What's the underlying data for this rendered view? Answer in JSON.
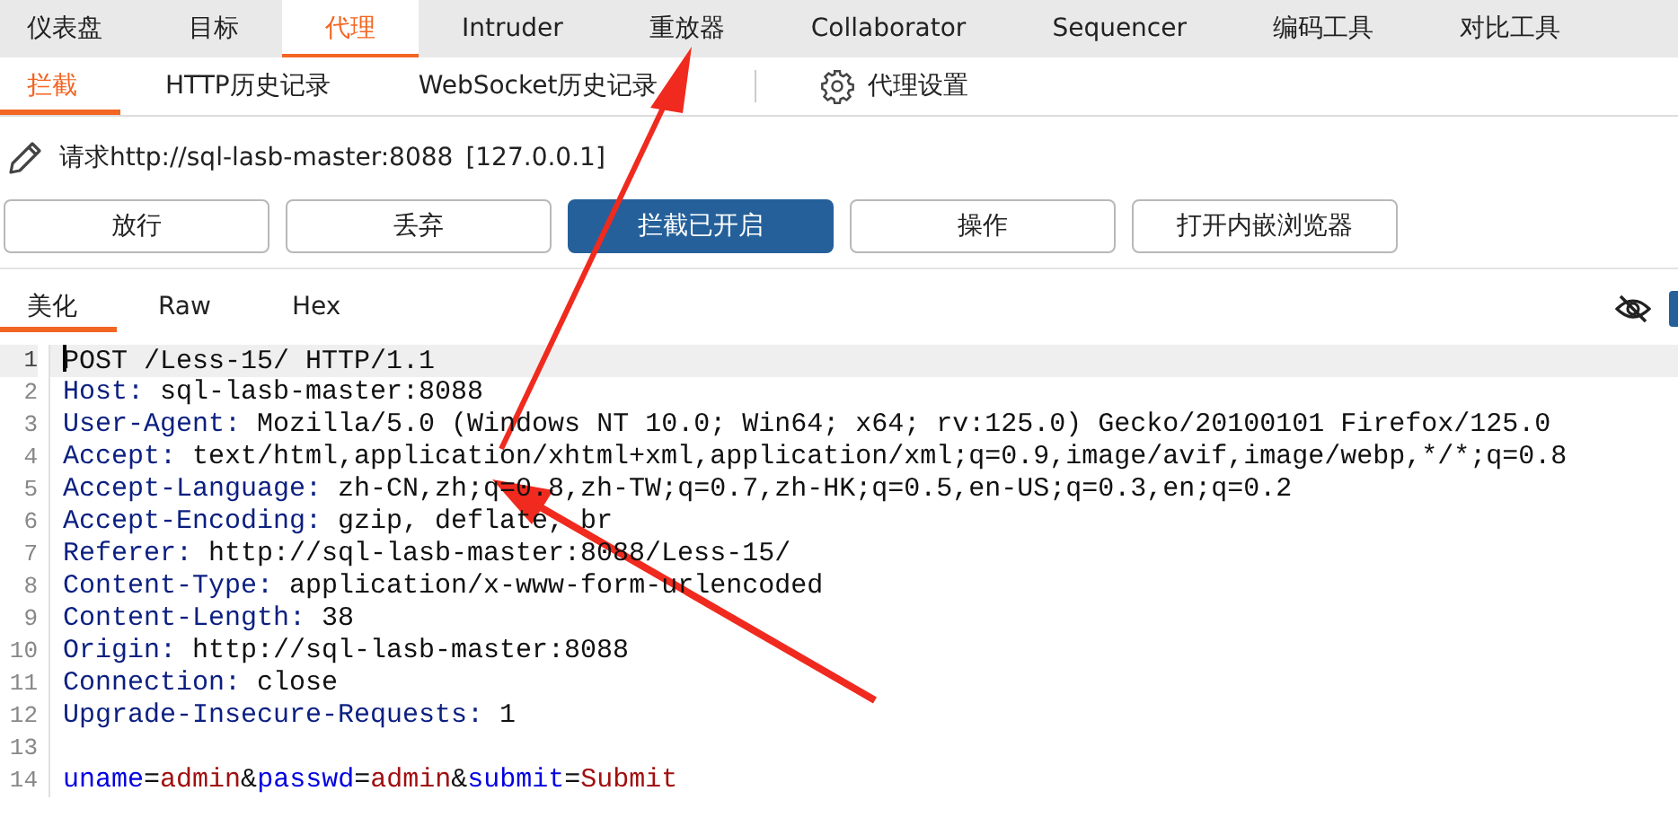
{
  "main_tabs": [
    {
      "label": "仪表盘",
      "selected": false
    },
    {
      "label": "目标",
      "selected": false
    },
    {
      "label": "代理",
      "selected": true
    },
    {
      "label": "Intruder",
      "selected": false
    },
    {
      "label": "重放器",
      "selected": false
    },
    {
      "label": "Collaborator",
      "selected": false
    },
    {
      "label": "Sequencer",
      "selected": false
    },
    {
      "label": "编码工具",
      "selected": false
    },
    {
      "label": "对比工具",
      "selected": false
    }
  ],
  "sub_tabs": [
    {
      "label": "拦截",
      "selected": true
    },
    {
      "label": "HTTP历史记录",
      "selected": false
    },
    {
      "label": "WebSocket历史记录",
      "selected": false
    }
  ],
  "settings_label": "代理设置",
  "request_info": {
    "url": "请求http://sql-lasb-master:8088",
    "ip": "[127.0.0.1]"
  },
  "buttons": [
    {
      "label": "放行",
      "on": false
    },
    {
      "label": "丢弃",
      "on": false
    },
    {
      "label": "拦截已开启",
      "on": true
    },
    {
      "label": "操作",
      "on": false
    },
    {
      "label": "打开内嵌浏览器",
      "on": false
    }
  ],
  "editor_tabs": [
    {
      "label": "美化",
      "selected": true
    },
    {
      "label": "Raw",
      "selected": false
    },
    {
      "label": "Hex",
      "selected": false
    }
  ],
  "lines": [
    {
      "number": "1",
      "current": true,
      "segments": [
        {
          "kind": "plain",
          "text": "POST /Less-15/ HTTP/1.1"
        }
      ]
    },
    {
      "number": "2",
      "current": false,
      "segments": [
        {
          "kind": "header",
          "text": "Host:"
        },
        {
          "kind": "plain",
          "text": " sql-lasb-master:8088"
        }
      ]
    },
    {
      "number": "3",
      "current": false,
      "segments": [
        {
          "kind": "header",
          "text": "User-Agent:"
        },
        {
          "kind": "plain",
          "text": " Mozilla/5.0 (Windows NT 10.0; Win64; x64; rv:125.0) Gecko/20100101 Firefox/125.0"
        }
      ]
    },
    {
      "number": "4",
      "current": false,
      "segments": [
        {
          "kind": "header",
          "text": "Accept:"
        },
        {
          "kind": "plain",
          "text": " text/html,application/xhtml+xml,application/xml;q=0.9,image/avif,image/webp,*/*;q=0.8"
        }
      ]
    },
    {
      "number": "5",
      "current": false,
      "segments": [
        {
          "kind": "header",
          "text": "Accept-Language:"
        },
        {
          "kind": "plain",
          "text": " zh-CN,zh;q=0.8,zh-TW;q=0.7,zh-HK;q=0.5,en-US;q=0.3,en;q=0.2"
        }
      ]
    },
    {
      "number": "6",
      "current": false,
      "segments": [
        {
          "kind": "header",
          "text": "Accept-Encoding:"
        },
        {
          "kind": "plain",
          "text": " gzip, deflate, br"
        }
      ]
    },
    {
      "number": "7",
      "current": false,
      "segments": [
        {
          "kind": "header",
          "text": "Referer:"
        },
        {
          "kind": "plain",
          "text": " http://sql-lasb-master:8088/Less-15/"
        }
      ]
    },
    {
      "number": "8",
      "current": false,
      "segments": [
        {
          "kind": "header",
          "text": "Content-Type:"
        },
        {
          "kind": "plain",
          "text": " application/x-www-form-urlencoded"
        }
      ]
    },
    {
      "number": "9",
      "current": false,
      "segments": [
        {
          "kind": "header",
          "text": "Content-Length:"
        },
        {
          "kind": "plain",
          "text": " 38"
        }
      ]
    },
    {
      "number": "10",
      "current": false,
      "segments": [
        {
          "kind": "header",
          "text": "Origin:"
        },
        {
          "kind": "plain",
          "text": " http://sql-lasb-master:8088"
        }
      ]
    },
    {
      "number": "11",
      "current": false,
      "segments": [
        {
          "kind": "header",
          "text": "Connection:"
        },
        {
          "kind": "plain",
          "text": " close"
        }
      ]
    },
    {
      "number": "12",
      "current": false,
      "segments": [
        {
          "kind": "header",
          "text": "Upgrade-Insecure-Requests:"
        },
        {
          "kind": "plain",
          "text": " 1"
        }
      ]
    },
    {
      "number": "13",
      "current": false
    },
    {
      "number": "14",
      "current": false,
      "segments": [
        {
          "kind": "param",
          "text": "uname"
        },
        {
          "kind": "plain",
          "text": "="
        },
        {
          "kind": "pvalue",
          "text": "admin"
        },
        {
          "kind": "plain",
          "text": "&"
        },
        {
          "kind": "param",
          "text": "passwd"
        },
        {
          "kind": "plain",
          "text": "="
        },
        {
          "kind": "pvalue",
          "text": "admin"
        },
        {
          "kind": "plain",
          "text": "&"
        },
        {
          "kind": "param",
          "text": "submit"
        },
        {
          "kind": "plain",
          "text": "="
        },
        {
          "kind": "pvalue",
          "text": "Submit"
        }
      ]
    }
  ]
}
